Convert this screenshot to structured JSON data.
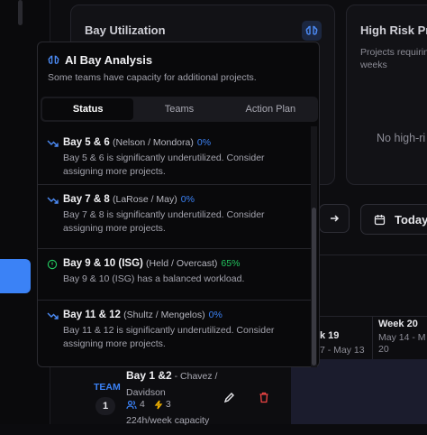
{
  "bay_card": {
    "title": "Bay Utilization"
  },
  "risk_card": {
    "title": "High Risk Pro",
    "desc": "Projects requirin weeks",
    "empty": "No high-ri"
  },
  "nav": {
    "today_label": "Today"
  },
  "calendar": {
    "weeks": [
      {
        "label": "k 19",
        "range": "7 - May 13"
      },
      {
        "label": "Week 20",
        "range": "May 14 - M 20"
      }
    ],
    "row": {
      "team_label": "TEAM",
      "team_number": "1",
      "bay_name": "Bay 1 &2",
      "managers": "- Chavez / Davidson",
      "members": "4",
      "projects": "3",
      "capacity": "224h/week capacity"
    }
  },
  "popover": {
    "title": "AI Bay Analysis",
    "subtitle": "Some teams have capacity for additional projects.",
    "tabs": [
      "Status",
      "Teams",
      "Action Plan"
    ],
    "active_tab": "Status",
    "items": [
      {
        "bay": "Bay 5 & 6",
        "teams": "(Nelson / Mondora)",
        "pct": "0%",
        "status": "under",
        "desc": "Bay 5 & 6 is significantly underutilized. Consider assigning more projects."
      },
      {
        "bay": "Bay 7 & 8",
        "teams": "(LaRose / May)",
        "pct": "0%",
        "status": "under",
        "desc": "Bay 7 & 8 is significantly underutilized. Consider assigning more projects."
      },
      {
        "bay": "Bay 9 & 10 (ISG)",
        "teams": "(Held / Overcast)",
        "pct": "65%",
        "status": "balanced",
        "desc": "Bay 9 & 10 (ISG) has a balanced workload."
      },
      {
        "bay": "Bay 11 & 12",
        "teams": "(Shultz / Mengelos)",
        "pct": "0%",
        "status": "under",
        "desc": "Bay 11 & 12 is significantly underutilized. Consider assigning more projects."
      }
    ]
  },
  "colors": {
    "accent": "#3b82f6",
    "under": "#3b82f6",
    "balanced": "#22c55e",
    "danger": "#ef4444",
    "bolt": "#f5b400"
  }
}
